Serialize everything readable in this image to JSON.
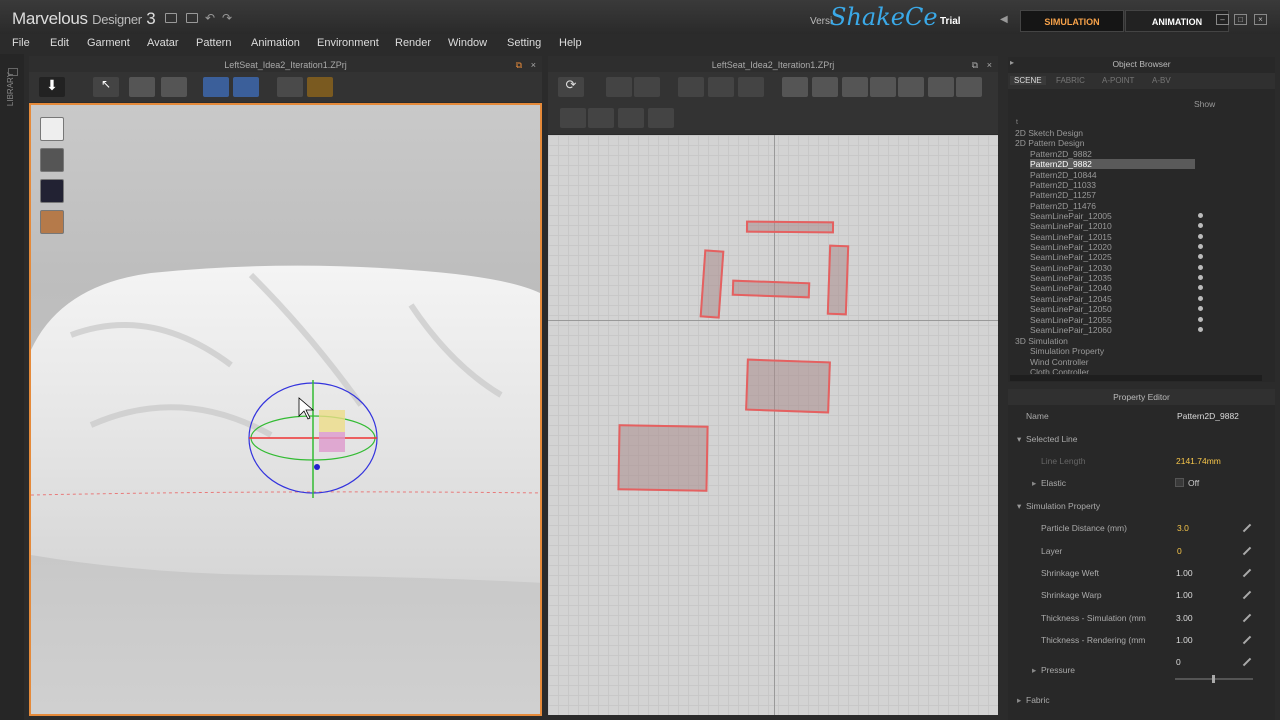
{
  "app": {
    "name": "Marvelous",
    "sub": "Designer",
    "ver": "3",
    "version_text": "Versi",
    "watermark": "ShakeCe",
    "trial": "Trial"
  },
  "modes": {
    "simulation": "SIMULATION",
    "animation": "ANIMATION"
  },
  "menu": [
    "File",
    "Edit",
    "Garment",
    "Avatar",
    "Pattern",
    "Animation",
    "Environment",
    "Render",
    "Window",
    "Setting",
    "Help"
  ],
  "library_label": "LIBRARY",
  "view3d_title": "LeftSeat_Idea2_Iteration1.ZPrj",
  "view2d_title": "LeftSeat_Idea2_Iteration1.ZPrj",
  "object_browser": {
    "title": "Object Browser",
    "tabs": [
      "SCENE",
      "FABRIC",
      "A-POINT",
      "A-BV"
    ],
    "show": "Show",
    "items": [
      "2D Sketch Design",
      "2D Pattern Design",
      "Pattern2D_9882",
      "Pattern2D_9882",
      "Pattern2D_10844",
      "Pattern2D_11033",
      "Pattern2D_11257",
      "Pattern2D_11476",
      "SeamLinePair_12005",
      "SeamLinePair_12010",
      "SeamLinePair_12015",
      "SeamLinePair_12020",
      "SeamLinePair_12025",
      "SeamLinePair_12030",
      "SeamLinePair_12035",
      "SeamLinePair_12040",
      "SeamLinePair_12045",
      "SeamLinePair_12050",
      "SeamLinePair_12055",
      "SeamLinePair_12060",
      "3D Simulation",
      "Simulation Property",
      "Wind Controller",
      "Cloth Controller"
    ]
  },
  "property_editor": {
    "title": "Property Editor",
    "name_label": "Name",
    "name_value": "Pattern2D_9882",
    "selected_line": "Selected Line",
    "line_length_label": "Line Length",
    "line_length_value": "2141.74mm",
    "elastic_label": "Elastic",
    "elastic_value": "Off",
    "sim_prop": "Simulation Property",
    "rows": [
      {
        "label": "Particle Distance (mm)",
        "value": "3.0"
      },
      {
        "label": "Layer",
        "value": "0"
      },
      {
        "label": "Shrinkage Weft",
        "value": "1.00"
      },
      {
        "label": "Shrinkage Warp",
        "value": "1.00"
      },
      {
        "label": "Thickness - Simulation (mm",
        "value": "3.00"
      },
      {
        "label": "Thickness - Rendering (mm",
        "value": "1.00"
      }
    ],
    "pressure_label": "Pressure",
    "pressure_value": "0",
    "fabric_label": "Fabric"
  },
  "colors": {
    "accent": "#f7a24a",
    "pattern_border": "#e56060",
    "watermark": "#3aa9e8"
  }
}
